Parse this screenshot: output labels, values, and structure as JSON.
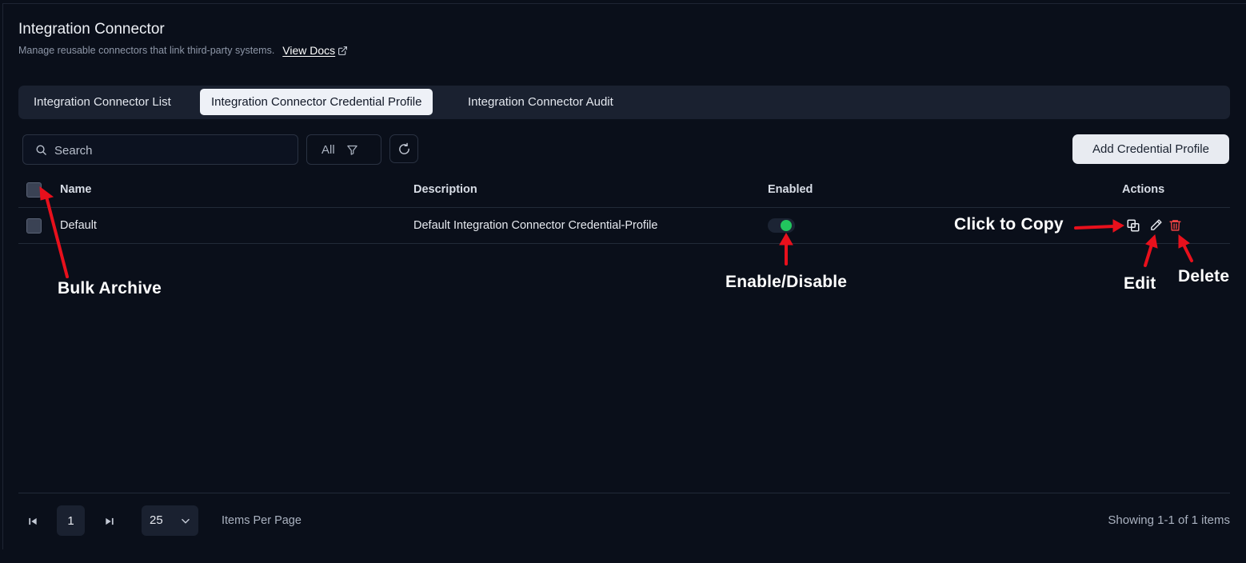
{
  "header": {
    "title": "Integration Connector",
    "subtitle": "Manage reusable connectors that link third-party systems.",
    "docs_link": "View Docs"
  },
  "tabs": [
    {
      "label": "Integration Connector List",
      "active": false
    },
    {
      "label": "Integration Connector Credential Profile",
      "active": true
    },
    {
      "label": "Integration Connector Audit",
      "active": false
    }
  ],
  "toolbar": {
    "search_placeholder": "Search",
    "filter_label": "All",
    "add_button": "Add Credential Profile"
  },
  "table": {
    "columns": [
      "Name",
      "Description",
      "Enabled",
      "Actions"
    ],
    "rows": [
      {
        "name": "Default",
        "description": "Default Integration Connector Credential-Profile",
        "enabled": true
      }
    ]
  },
  "annotations": {
    "bulk_archive": "Bulk Archive",
    "enable_disable": "Enable/Disable",
    "click_to_copy": "Click to Copy",
    "edit": "Edit",
    "delete": "Delete"
  },
  "pagination": {
    "current_page": "1",
    "per_page": "25",
    "per_page_label": "Items Per Page",
    "showing": "Showing 1-1 of 1 items"
  },
  "colors": {
    "background": "#0a0f1a",
    "toggle_on": "#22c55e",
    "delete": "#ef4444",
    "annotation_arrow": "#e8101c"
  }
}
